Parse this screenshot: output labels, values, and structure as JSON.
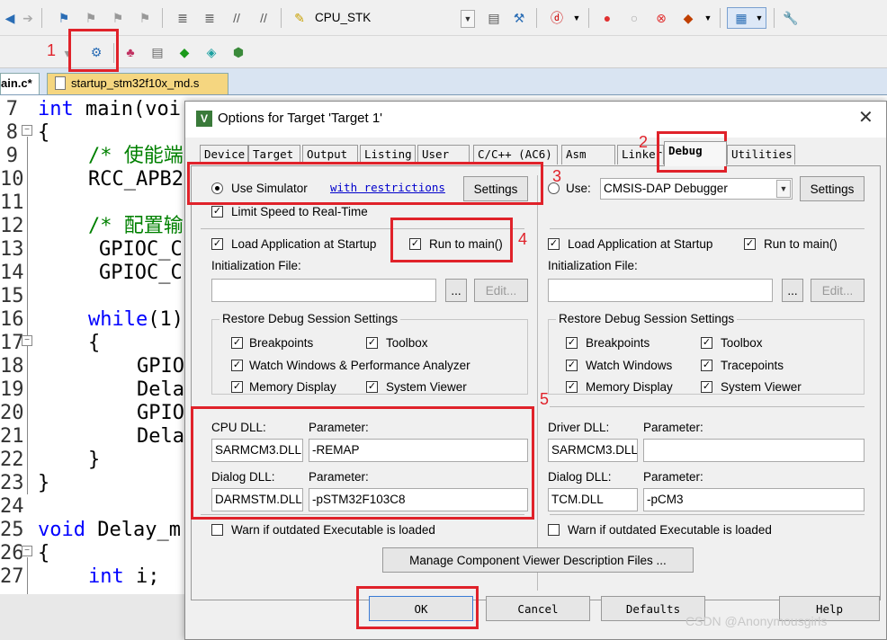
{
  "toolbar": {
    "target_name": "CPU_STK",
    "annotation_1": "1"
  },
  "file_tabs": [
    {
      "label": "main.c*",
      "display": "ain.c*"
    },
    {
      "label": "startup_stm32f10x_md.s"
    }
  ],
  "editor": {
    "line_numbers": [
      "7",
      "8",
      "9",
      "10",
      "11",
      "12",
      "13",
      "14",
      "15",
      "16",
      "17",
      "18",
      "19",
      "20",
      "21",
      "22",
      "23",
      "24",
      "25",
      "26",
      "27"
    ],
    "lines": {
      "l7a": "int",
      "l7b": " main(voi",
      "l9": "/* 使能端",
      "l10": "RCC_APB2",
      "l12": "/* 配置输",
      "l13": "GPIOC_C",
      "l14": "GPIOC_C",
      "l16a": "while",
      "l16b": "(1)",
      "l17": "{",
      "l18": "GPIO",
      "l19": "Dela",
      "l20": "GPIO",
      "l21": "Dela",
      "l22": "}",
      "l23": "}",
      "l25a": "void",
      "l25b": " Delay_m",
      "l26": "{",
      "l27a": "int",
      "l27b": " i;"
    }
  },
  "dialog": {
    "title": "Options for Target 'Target 1'",
    "close": "✕",
    "tabs": [
      "Device",
      "Target",
      "Output",
      "Listing",
      "User",
      "C/C++ (AC6)",
      "Asm",
      "Linker",
      "Debug",
      "Utilities"
    ],
    "active_tab": "Debug",
    "left": {
      "use_simulator": "Use Simulator",
      "restrictions_link": "with restrictions",
      "settings": "Settings",
      "limit_speed": "Limit Speed to Real-Time",
      "load_app": "Load Application at Startup",
      "run_to_main": "Run to main()",
      "init_file_label": "Initialization File:",
      "init_file_value": "",
      "browse": "...",
      "edit": "Edit...",
      "restore_group": "Restore Debug Session Settings",
      "breakpoints": "Breakpoints",
      "toolbox": "Toolbox",
      "watch_windows": "Watch Windows & Performance Analyzer",
      "memory_display": "Memory Display",
      "system_viewer": "System Viewer",
      "cpu_dll_label": "CPU DLL:",
      "cpu_param_label": "Parameter:",
      "cpu_dll": "SARMCM3.DLL",
      "cpu_param": "-REMAP",
      "dialog_dll_label": "Dialog DLL:",
      "dialog_param_label": "Parameter:",
      "dialog_dll": "DARMSTM.DLL",
      "dialog_param": "-pSTM32F103C8",
      "warn": "Warn if outdated Executable is loaded"
    },
    "right": {
      "use": "Use:",
      "debugger": "CMSIS-DAP Debugger",
      "settings": "Settings",
      "load_app": "Load Application at Startup",
      "run_to_main": "Run to main()",
      "init_file_label": "Initialization File:",
      "init_file_value": "",
      "browse": "...",
      "edit": "Edit...",
      "restore_group": "Restore Debug Session Settings",
      "breakpoints": "Breakpoints",
      "toolbox": "Toolbox",
      "watch_windows": "Watch Windows",
      "tracepoints": "Tracepoints",
      "memory_display": "Memory Display",
      "system_viewer": "System Viewer",
      "driver_dll_label": "Driver DLL:",
      "driver_param_label": "Parameter:",
      "driver_dll": "SARMCM3.DLL",
      "driver_param": "",
      "dialog_dll_label": "Dialog DLL:",
      "dialog_param_label": "Parameter:",
      "dialog_dll": "TCM.DLL",
      "dialog_param": "-pCM3",
      "warn": "Warn if outdated Executable is loaded"
    },
    "manage_btn": "Manage Component Viewer Description Files ...",
    "ok": "OK",
    "cancel": "Cancel",
    "defaults": "Defaults",
    "help": "Help"
  },
  "annotations": [
    "1",
    "2",
    "3",
    "4",
    "5"
  ],
  "watermark": "CSDN @Anonymousgirls",
  "colors": {
    "highlight": "#e0222a",
    "keyword": "#0000ff",
    "comment": "#008000"
  }
}
